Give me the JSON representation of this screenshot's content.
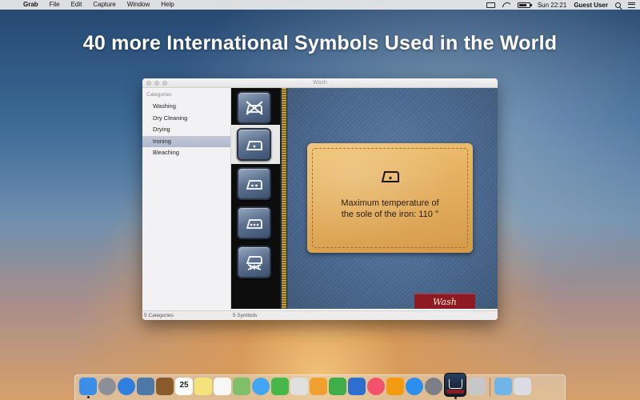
{
  "menubar": {
    "apple_glyph": "",
    "app_name": "Grab",
    "menus": [
      "File",
      "Edit",
      "Capture",
      "Window",
      "Help"
    ],
    "clock": "Sun 22:21",
    "user": "Guest User",
    "status_icons": [
      "airplay-icon",
      "wifi-icon",
      "battery-icon"
    ],
    "battery_level": 0.8
  },
  "headline": "40 more International Symbols Used in the World",
  "window": {
    "title": "Wash",
    "sidebar": {
      "header": "Categories",
      "items": [
        "Washing",
        "Dry Cleaning",
        "Drying",
        "Ironing",
        "Bleaching"
      ],
      "selected": "Ironing"
    },
    "symbols": [
      {
        "icon": "iron-do-not-icon",
        "selected": false
      },
      {
        "icon": "iron-low-icon",
        "selected": true
      },
      {
        "icon": "iron-medium-icon",
        "selected": false
      },
      {
        "icon": "iron-high-icon",
        "selected": false
      },
      {
        "icon": "iron-no-steam-icon",
        "selected": false
      }
    ],
    "detail": {
      "icon": "iron-low-icon",
      "description_line1": "Maximum temperature of",
      "description_line2": "the sole of the iron: 110 °",
      "tag_label": "Wash"
    },
    "status": {
      "categories_count": "5 Categories",
      "symbols_count": "5 Symbols"
    }
  },
  "dock": {
    "apps": [
      {
        "name": "finder-icon",
        "color": "#3a8ee6"
      },
      {
        "name": "launchpad-icon",
        "color": "#8a8f99"
      },
      {
        "name": "safari-icon",
        "color": "#2f7fe0"
      },
      {
        "name": "photo-icon",
        "color": "#4d79a8"
      },
      {
        "name": "notes-book-icon",
        "color": "#8a5a2b"
      },
      {
        "name": "calendar-icon",
        "color": "#ffffff",
        "text": "25"
      },
      {
        "name": "notes-icon",
        "color": "#f4e27a"
      },
      {
        "name": "reminders-icon",
        "color": "#f7f7f7"
      },
      {
        "name": "maps-icon",
        "color": "#7fbf6a"
      },
      {
        "name": "messages-icon",
        "color": "#42a5f5"
      },
      {
        "name": "facetime-icon",
        "color": "#46b84a"
      },
      {
        "name": "photos-icon",
        "color": "#e0e0e0"
      },
      {
        "name": "pages-icon",
        "color": "#f0a030"
      },
      {
        "name": "numbers-icon",
        "color": "#3fae49"
      },
      {
        "name": "keynote-icon",
        "color": "#2d6fcf"
      },
      {
        "name": "music-icon",
        "color": "#f2526c"
      },
      {
        "name": "ibooks-icon",
        "color": "#f39c12"
      },
      {
        "name": "app-store-icon",
        "color": "#2c8ff0"
      },
      {
        "name": "system-preferences-icon",
        "color": "#7c7f86"
      }
    ],
    "after_active": [
      {
        "name": "preview-icon",
        "color": "#c7c7c7"
      }
    ],
    "trailing": [
      {
        "name": "downloads-folder-icon",
        "color": "#6fb5e8"
      },
      {
        "name": "trash-icon",
        "color": "#d9dde3"
      }
    ]
  }
}
